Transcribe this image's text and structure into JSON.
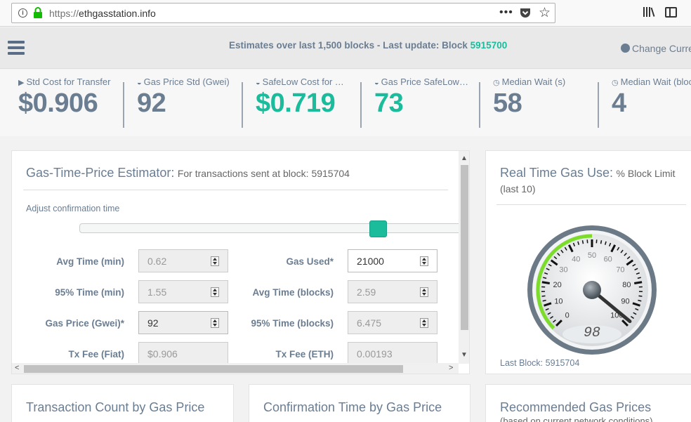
{
  "browser": {
    "url_scheme": "https://",
    "url_host": "ethgasstation.info",
    "more_glyph": "•••",
    "star_glyph": "☆"
  },
  "header": {
    "estimates_label": "Estimates over last 1,500 blocks - Last update: Block",
    "last_block": "5915700",
    "change_currency": "Change Curren"
  },
  "stats": [
    {
      "icon": "truck-icon",
      "label": "Std Cost for Transfer",
      "value": "$0.906",
      "color": "#6b7d91"
    },
    {
      "icon": "tachometer-icon",
      "label": "Gas Price Std (Gwei)",
      "value": "92",
      "color": "#6b7d91"
    },
    {
      "icon": "tachometer-icon",
      "label": "SafeLow Cost for Transfer",
      "value": "$0.719",
      "color": "#1abc9c"
    },
    {
      "icon": "tachometer-icon",
      "label": "Gas Price SafeLow (Gwei)",
      "value": "73",
      "color": "#1abc9c"
    },
    {
      "icon": "clock-icon",
      "label": "Median Wait (s)",
      "value": "58",
      "color": "#6b7d91"
    },
    {
      "icon": "clock-icon",
      "label": "Median Wait (blocks)",
      "value": "4",
      "color": "#6b7d91"
    }
  ],
  "estimator": {
    "title": "Gas-Time-Price Estimator:",
    "subtitle": "For transactions sent at block: 5915704",
    "adjust_label": "Adjust confirmation time",
    "fields": {
      "avg_time_min": {
        "label": "Avg Time (min)",
        "value": "0.62"
      },
      "time95_min": {
        "label": "95% Time (min)",
        "value": "1.55"
      },
      "gas_price": {
        "label": "Gas Price (Gwei)*",
        "value": "92"
      },
      "tx_fee_fiat": {
        "label": "Tx Fee (Fiat)",
        "value": "$0.906"
      },
      "gas_used": {
        "label": "Gas Used*",
        "value": "21000"
      },
      "avg_time_blocks": {
        "label": "Avg Time (blocks)",
        "value": "2.59"
      },
      "time95_blocks": {
        "label": "95% Time (blocks)",
        "value": "6.475"
      },
      "tx_fee_eth": {
        "label": "Tx Fee (ETH)",
        "value": "0.00193"
      }
    },
    "scroll_up": "▲",
    "scroll_down": "▼",
    "scroll_left": "<",
    "scroll_right": ">"
  },
  "realtime": {
    "title": "Real Time Gas Use:",
    "subtitle": "% Block Limit (last 10)",
    "gauge_value": 98,
    "gauge_display": "98",
    "ticks": [
      "0",
      "10",
      "20",
      "30",
      "40",
      "50",
      "60",
      "70",
      "80",
      "90",
      "100"
    ],
    "last_block": "Last Block: 5915704",
    "accent": "#7cdc2a"
  },
  "bottom": {
    "tx_count": "Transaction Count by Gas Price",
    "conf_time": "Confirmation Time by Gas Price",
    "recommended": "Recommended Gas Prices",
    "recommended_sub": "(based on current network conditions)"
  }
}
